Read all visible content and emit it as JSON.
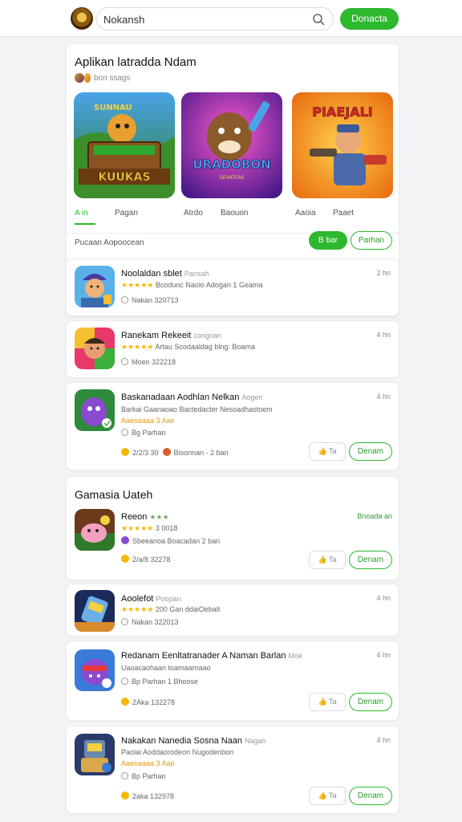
{
  "header": {
    "search_value": "Nokansh",
    "donate_label": "Donacta"
  },
  "featured": {
    "title": "Aplikan latradda Ndam",
    "subtitle": "bon ssags",
    "tiles": [
      {
        "name": "game-tile-1",
        "banner": "KUUKAS",
        "top_text": "SUNNAU"
      },
      {
        "name": "game-tile-2",
        "banner": "URADOBON",
        "sub": "GEVATEAS"
      },
      {
        "name": "game-tile-3",
        "banner": "PIAEJALI"
      }
    ],
    "tabs": [
      "A in",
      "Pagan",
      "Atrdo",
      "Baouon",
      "Aaoia",
      "Paaet"
    ],
    "filter_label": "Pucaan Aopoocean",
    "filter_btn": "B bar",
    "filter_btn2": "Parhan"
  },
  "apps": [
    {
      "title": "Noolaldan sblet",
      "title_sub": "Pansah",
      "size": "2 hn",
      "stars": "★★★★★",
      "line2": "Bcodunc Naolo Adogan 1 Geama",
      "line3": "Nakan 320713"
    },
    {
      "title": "Ranekam Rekeeit",
      "title_sub": "congoan",
      "size": "4 hn",
      "stars": "★★★★★",
      "line2": "Artau Scodaaldag blng: Boama",
      "line3": "Moen 322218"
    },
    {
      "title": "Baskanadaan Aodhlan Nelkan",
      "title_sub": "Aogen",
      "size": "4 hn",
      "line2": "Barkai Gaanaoao Bactedacter Nesoadhastoem",
      "line2_orange": "Aaeoaaaa 3 Aae",
      "line3": "Bg Parhan",
      "foot_left": "2/2/3 30",
      "foot_mid": "Bisonnan - 2 ban",
      "btn1": "Ta",
      "btn2": "Denam"
    }
  ],
  "recent": {
    "title": "Gamasia Uateh",
    "apps": [
      {
        "title": "Reeon",
        "size": "Bnoada an",
        "stars": "★★★★★",
        "line2_extra": "3 0018",
        "line3": "Sbeeanoa Boacadan 2 ban",
        "foot_left": "2/a/8 32278",
        "btn1": "Ta",
        "btn2": "Denam"
      },
      {
        "title": "Aoolefot",
        "title_sub": "Poopan",
        "size": "4 hn",
        "stars": "★★★★★",
        "line2_extra": "200 Gan ddaiOebalt",
        "line3": "Nakan 322013"
      },
      {
        "title": "Redanam Eenltatranader A Naman Barlan",
        "title_sub": "Moe",
        "size": "4 hn",
        "line2": "Uaoacaohaan toamaarnaao",
        "line3": "Bp Parhan 1 Bhoose",
        "foot_left": "2Aka 132278",
        "btn1": "Ta",
        "btn2": "Denam"
      },
      {
        "title": "Nakakan Nanedia Sosna Naan",
        "title_sub": "Nagan",
        "size": "4 hn",
        "line2": "Paolai Aoddaorodeon Nugodenbon",
        "line2_orange": "Aaeoaaaa 3 Aae",
        "line3": "Bp Parhan",
        "foot_left": "2aka 132978",
        "btn1": "Ta",
        "btn2": "Denam"
      }
    ]
  }
}
